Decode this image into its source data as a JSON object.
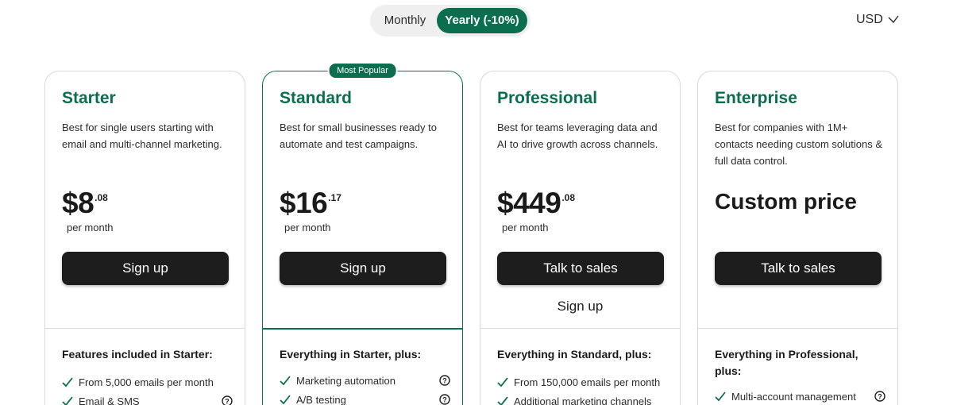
{
  "billing_toggle": {
    "monthly": "Monthly",
    "yearly": "Yearly (-10%)"
  },
  "currency": {
    "label": "USD"
  },
  "colors": {
    "accent": "#0b6e4f",
    "button": "#1d1d1d"
  },
  "plans": [
    {
      "name": "Starter",
      "description": "Best for single users starting with email and multi-channel marketing.",
      "price_main": "$8",
      "price_cents": ".08",
      "period": "per month",
      "cta": "Sign up",
      "features_title": "Features included in Starter:",
      "features": [
        {
          "label": "From 5,000 emails per month",
          "help": false
        },
        {
          "label": "Email & SMS",
          "help": true
        }
      ]
    },
    {
      "name": "Standard",
      "badge": "Most Popular",
      "description": "Best for small businesses ready to automate and test campaigns.",
      "price_main": "$16",
      "price_cents": ".17",
      "period": "per month",
      "cta": "Sign up",
      "features_title": "Everything in Starter, plus:",
      "features": [
        {
          "label": "Marketing automation",
          "help": true
        },
        {
          "label": "A/B testing",
          "help": true
        }
      ]
    },
    {
      "name": "Professional",
      "description": "Best for teams leveraging data and AI to drive growth across channels.",
      "price_main": "$449",
      "price_cents": ".08",
      "period": "per month",
      "cta": "Talk to sales",
      "secondary_cta": "Sign up",
      "features_title": "Everything in Standard, plus:",
      "features": [
        {
          "label": "From 150,000 emails per month",
          "help": false
        },
        {
          "label": "Additional marketing channels",
          "help": false
        }
      ]
    },
    {
      "name": "Enterprise",
      "description": "Best for companies with 1M+ contacts needing custom solutions & full data control.",
      "custom_price": "Custom price",
      "cta": "Talk to sales",
      "features_title": "Everything in Professional, plus:",
      "features": [
        {
          "label": "Multi-account management",
          "help": true
        }
      ]
    }
  ]
}
